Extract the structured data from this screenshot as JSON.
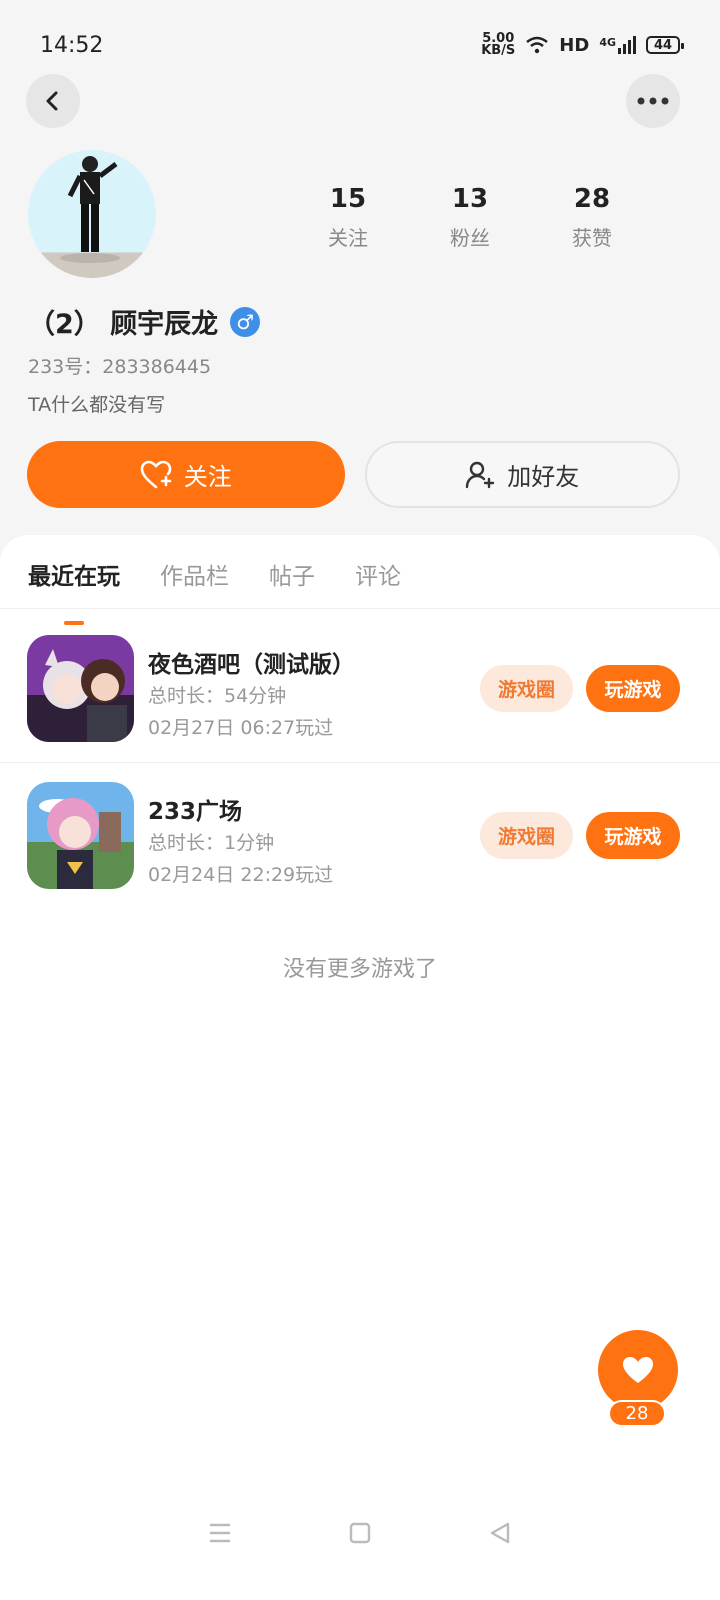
{
  "status": {
    "time": "14:52",
    "speed_top": "5.00",
    "speed_bottom": "KB/S",
    "hd": "HD",
    "network": "4G",
    "battery": "44"
  },
  "profile": {
    "stats": [
      {
        "num": "15",
        "label": "关注"
      },
      {
        "num": "13",
        "label": "粉丝"
      },
      {
        "num": "28",
        "label": "获赞"
      }
    ],
    "name": "（2） 顾宇辰龙",
    "gender_symbol": "♂",
    "uid": "233号：283386445",
    "bio": "TA什么都没有写",
    "follow_label": "关注",
    "add_friend_label": "加好友"
  },
  "tabs": [
    "最近在玩",
    "作品栏",
    "帖子",
    "评论"
  ],
  "games": [
    {
      "title": "夜色酒吧（测试版）",
      "duration": "总时长：54分钟",
      "date": "02月27日 06:27玩过",
      "circle_label": "游戏圈",
      "play_label": "玩游戏"
    },
    {
      "title": "233广场",
      "duration": "总时长：1分钟",
      "date": "02月24日 22:29玩过",
      "circle_label": "游戏圈",
      "play_label": "玩游戏"
    }
  ],
  "no_more": "没有更多游戏了",
  "fab_count": "28",
  "colors": {
    "accent": "#ff7212",
    "accent_light": "#fde8dc",
    "gender": "#3f8ee8"
  }
}
